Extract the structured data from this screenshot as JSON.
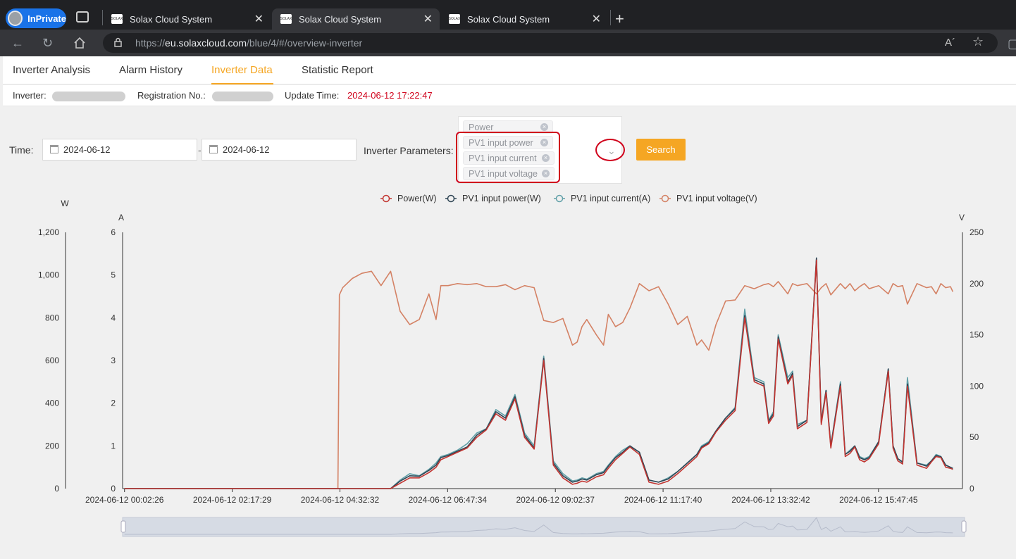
{
  "browser": {
    "inprivate_label": "InPrivate",
    "tabs": [
      {
        "title": "Solax Cloud System",
        "favicon": "SOLAX"
      },
      {
        "title": "Solax Cloud System",
        "favicon": "SOLAX"
      },
      {
        "title": "Solax Cloud System",
        "favicon": "SOLAX"
      }
    ],
    "url_prefix": "https://",
    "url_host": "eu.solaxcloud.com",
    "url_path": "/blue/4/#/overview-inverter",
    "reader_icon": "A´"
  },
  "nav": {
    "items": [
      "Inverter Analysis",
      "Alarm History",
      "Inverter Data",
      "Statistic Report"
    ],
    "active": "Inverter Data"
  },
  "info": {
    "inverter_label": "Inverter:",
    "registration_label": "Registration No.:",
    "update_label": "Update Time:",
    "update_value": "2024-06-12 17:22:47"
  },
  "filters": {
    "time_label": "Time:",
    "date_from": "2024-06-12",
    "date_to": "2024-06-12",
    "date_separator": "-",
    "params_label": "Inverter Parameters:",
    "tags": [
      "Power",
      "PV1 input power",
      "PV1 input current",
      "PV1 input voltage"
    ],
    "search_label": "Search"
  },
  "colors": {
    "accent": "#f5a623",
    "power": "#c23531",
    "pv_power": "#2f4554",
    "pv_current": "#61a0a8",
    "pv_voltage": "#d48265"
  },
  "chart_data": {
    "type": "line",
    "legend": [
      "Power(W)",
      "PV1 input power(W)",
      "PV1 input current(A)",
      "PV1 input voltage(V)"
    ],
    "legend_position": "top",
    "axes": {
      "left_W": {
        "label": "W",
        "ticks": [
          "0",
          "200",
          "400",
          "600",
          "800",
          "1,000",
          "1,200"
        ],
        "range": [
          0,
          1200
        ]
      },
      "left_A": {
        "label": "A",
        "ticks": [
          "0",
          "1",
          "2",
          "3",
          "4",
          "5",
          "6"
        ],
        "range": [
          0,
          6
        ]
      },
      "right_V": {
        "label": "V",
        "ticks": [
          "0",
          "50",
          "100",
          "150",
          "200",
          "250"
        ],
        "range": [
          0,
          250
        ]
      },
      "x_ticks": [
        "2024-06-12 00:02:26",
        "2024-06-12 02:17:29",
        "2024-06-12 04:32:32",
        "2024-06-12 06:47:34",
        "2024-06-12 09:02:37",
        "2024-06-12 11:17:40",
        "2024-06-12 13:32:42",
        "2024-06-12 15:47:45"
      ]
    },
    "x_hours": [
      0.04,
      1.0,
      2.0,
      3.0,
      4.0,
      4.5,
      4.53,
      4.6,
      4.8,
      5.0,
      5.2,
      5.4,
      5.6,
      5.8,
      6.0,
      6.2,
      6.4,
      6.55,
      6.65,
      6.8,
      7.0,
      7.2,
      7.4,
      7.6,
      7.8,
      8.0,
      8.2,
      8.4,
      8.6,
      8.8,
      9.0,
      9.2,
      9.4,
      9.5,
      9.6,
      9.7,
      9.9,
      10.05,
      10.15,
      10.3,
      10.45,
      10.6,
      10.8,
      11.0,
      11.2,
      11.4,
      11.6,
      11.8,
      12.0,
      12.1,
      12.25,
      12.4,
      12.6,
      12.8,
      13.0,
      13.2,
      13.4,
      13.5,
      13.6,
      13.7,
      13.9,
      14.0,
      14.1,
      14.3,
      14.5,
      14.6,
      14.7,
      14.8,
      15.0,
      15.1,
      15.2,
      15.3,
      15.4,
      15.5,
      15.6,
      15.8,
      16.0,
      16.1,
      16.2,
      16.3,
      16.4,
      16.6,
      16.8,
      16.9,
      17.0,
      17.1,
      17.2,
      17.3,
      17.35
    ],
    "series": [
      {
        "name": "PV1 input voltage(V)",
        "axis": "right_V",
        "values": [
          0,
          0,
          0,
          0,
          0,
          0,
          189,
          196,
          205,
          210,
          212,
          198,
          212,
          173,
          160,
          165,
          190,
          165,
          198,
          198,
          200,
          199,
          200,
          197,
          197,
          199,
          194,
          198,
          196,
          164,
          162,
          166,
          140,
          143,
          158,
          165,
          150,
          140,
          170,
          158,
          162,
          176,
          200,
          193,
          197,
          180,
          160,
          168,
          140,
          145,
          135,
          160,
          183,
          184,
          198,
          195,
          199,
          200,
          197,
          202,
          190,
          200,
          198,
          200,
          190,
          196,
          200,
          189,
          200,
          195,
          200,
          193,
          197,
          200,
          195,
          198,
          190,
          200,
          197,
          198,
          180,
          200,
          196,
          197,
          190,
          200,
          196,
          197,
          192
        ]
      },
      {
        "name": "PV1 input current(A)",
        "axis": "left_A",
        "values": [
          0,
          0,
          0,
          0,
          0,
          0,
          0,
          0,
          0,
          0,
          0,
          0,
          0,
          0.2,
          0.35,
          0.3,
          0.45,
          0.6,
          0.75,
          0.8,
          0.9,
          1.05,
          1.3,
          1.4,
          1.85,
          1.7,
          2.2,
          1.3,
          1.0,
          3.1,
          0.65,
          0.35,
          0.18,
          0.2,
          0.25,
          0.22,
          0.35,
          0.4,
          0.55,
          0.75,
          0.9,
          1.0,
          0.85,
          0.2,
          0.15,
          0.25,
          0.4,
          0.6,
          0.8,
          1.0,
          1.1,
          1.35,
          1.65,
          1.9,
          4.2,
          2.6,
          2.5,
          1.6,
          1.8,
          3.6,
          2.6,
          2.75,
          1.5,
          1.6,
          5.4,
          1.6,
          2.3,
          1.0,
          2.5,
          0.8,
          0.9,
          1.0,
          0.75,
          0.7,
          0.75,
          1.1,
          2.8,
          1.0,
          0.7,
          0.6,
          2.6,
          0.6,
          0.55,
          0.65,
          0.8,
          0.75,
          0.55,
          0.5,
          0.45
        ]
      },
      {
        "name": "PV1 input power(W)",
        "axis": "left_W",
        "values": [
          0,
          0,
          0,
          0,
          0,
          0,
          0,
          0,
          0,
          0,
          0,
          0,
          0,
          35,
          60,
          58,
          85,
          110,
          145,
          155,
          175,
          195,
          250,
          280,
          360,
          330,
          430,
          250,
          190,
          610,
          120,
          60,
          30,
          35,
          45,
          40,
          65,
          75,
          105,
          145,
          170,
          200,
          170,
          40,
          30,
          45,
          80,
          120,
          160,
          195,
          215,
          270,
          330,
          375,
          810,
          510,
          490,
          315,
          350,
          710,
          500,
          540,
          290,
          320,
          1080,
          310,
          460,
          200,
          490,
          160,
          175,
          200,
          145,
          135,
          145,
          220,
          560,
          200,
          140,
          125,
          490,
          120,
          105,
          130,
          155,
          150,
          110,
          100,
          95
        ]
      },
      {
        "name": "Power(W)",
        "axis": "left_W",
        "values": [
          0,
          0,
          0,
          0,
          0,
          0,
          0,
          0,
          0,
          0,
          0,
          0,
          0,
          25,
          50,
          50,
          75,
          100,
          135,
          150,
          170,
          190,
          240,
          275,
          350,
          320,
          420,
          240,
          185,
          600,
          110,
          50,
          20,
          25,
          35,
          30,
          55,
          65,
          95,
          135,
          165,
          195,
          160,
          30,
          20,
          35,
          70,
          110,
          150,
          190,
          210,
          265,
          320,
          365,
          800,
          500,
          480,
          305,
          340,
          700,
          490,
          530,
          280,
          310,
          1070,
          300,
          450,
          190,
          480,
          150,
          165,
          195,
          135,
          125,
          140,
          210,
          550,
          190,
          130,
          115,
          480,
          110,
          95,
          125,
          150,
          145,
          100,
          95,
          90
        ]
      }
    ]
  }
}
